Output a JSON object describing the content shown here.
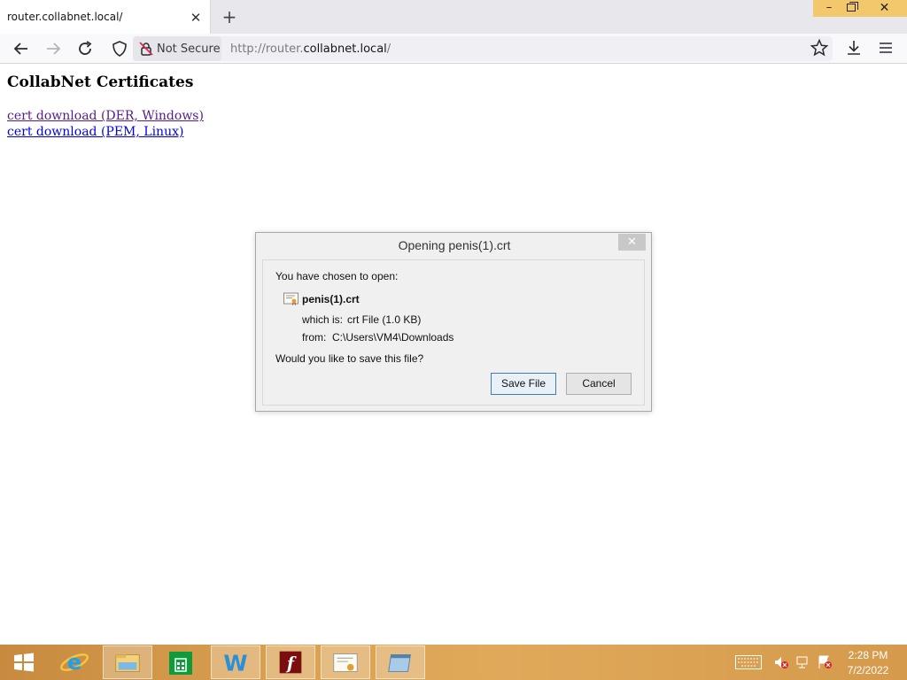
{
  "browser": {
    "tab_title": "router.collabnet.local/",
    "tab_close": "✕",
    "new_tab": "+",
    "window_controls": {
      "minimize": "–",
      "close": "✕"
    },
    "security_label": "Not Secure",
    "url_prefix": "http://router.",
    "url_host": "collabnet.local",
    "url_suffix": "/"
  },
  "page": {
    "heading": "CollabNet Certificates",
    "links": [
      {
        "label": "cert download (DER, Windows)",
        "visited": true
      },
      {
        "label": "cert download (PEM, Linux)",
        "visited": false
      }
    ],
    "colors": {
      "visited_link": "#551a8b",
      "link": "#0000ee"
    }
  },
  "dialog": {
    "title": "Opening penis(1).crt",
    "close": "✕",
    "prompt": "You have chosen to open:",
    "file_name": "penis(1).crt",
    "type_label": "which is:",
    "type_value": "crt File (1.0 KB)",
    "from_label": "from:",
    "from_value": "C:\\Users\\VM4\\Downloads",
    "save_question": "Would you like to save this file?",
    "save_button": "Save File",
    "cancel_button": "Cancel"
  },
  "taskbar": {
    "apps": [
      "start-icon",
      "internet-explorer-icon",
      "file-explorer-icon",
      "store-icon",
      "waterfox-icon",
      "flash-icon",
      "certificate-icon",
      "window-icon"
    ],
    "active_app": "waterfox-icon",
    "clock_time": "2:28 PM",
    "clock_date": "7/2/2022",
    "accent": "#d9a050"
  }
}
